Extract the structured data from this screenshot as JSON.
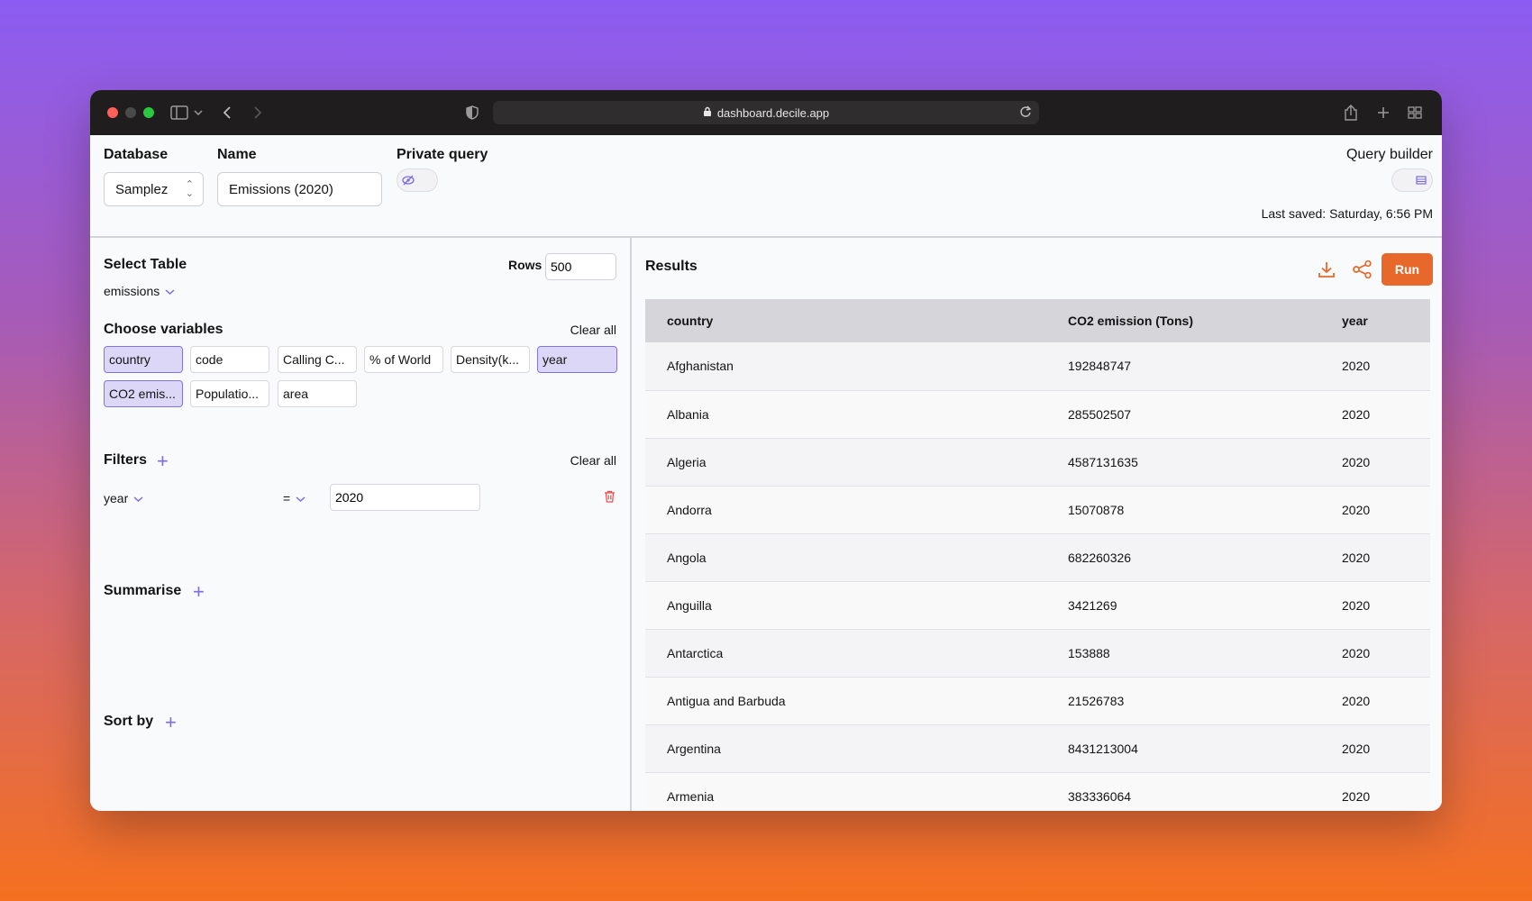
{
  "browser": {
    "url": "dashboard.decile.app"
  },
  "header": {
    "database_label": "Database",
    "database_value": "Samplez",
    "name_label": "Name",
    "name_value": "Emissions (2020)",
    "private_label": "Private query",
    "builder_label": "Query builder",
    "last_saved": "Last saved: Saturday, 6:56 PM"
  },
  "left": {
    "select_table_label": "Select Table",
    "rows_label": "Rows",
    "rows_value": "500",
    "table_value": "emissions",
    "choose_variables_label": "Choose variables",
    "clear_all": "Clear all",
    "variables": [
      {
        "label": "country",
        "selected": true
      },
      {
        "label": "code",
        "selected": false
      },
      {
        "label": "Calling C...",
        "selected": false
      },
      {
        "label": "% of World",
        "selected": false
      },
      {
        "label": "Density(k...",
        "selected": false
      },
      {
        "label": "year",
        "selected": true
      },
      {
        "label": "CO2 emis...",
        "selected": true
      },
      {
        "label": "Populatio...",
        "selected": false
      },
      {
        "label": "area",
        "selected": false
      }
    ],
    "filters_label": "Filters",
    "filters_clear_all": "Clear all",
    "filter": {
      "field": "year",
      "operator": "=",
      "value": "2020"
    },
    "summarise_label": "Summarise",
    "sort_by_label": "Sort by"
  },
  "results": {
    "title": "Results",
    "run_label": "Run",
    "columns": [
      "country",
      "CO2 emission (Tons)",
      "year"
    ],
    "rows": [
      [
        "Afghanistan",
        "192848747",
        "2020"
      ],
      [
        "Albania",
        "285502507",
        "2020"
      ],
      [
        "Algeria",
        "4587131635",
        "2020"
      ],
      [
        "Andorra",
        "15070878",
        "2020"
      ],
      [
        "Angola",
        "682260326",
        "2020"
      ],
      [
        "Anguilla",
        "3421269",
        "2020"
      ],
      [
        "Antarctica",
        "153888",
        "2020"
      ],
      [
        "Antigua and Barbuda",
        "21526783",
        "2020"
      ],
      [
        "Argentina",
        "8431213004",
        "2020"
      ],
      [
        "Armenia",
        "383336064",
        "2020"
      ]
    ]
  },
  "colors": {
    "accent": "#7c6ae6",
    "run": "#e8682c",
    "selected_chip": "#dcd6f7",
    "delete": "#e34b4b"
  }
}
